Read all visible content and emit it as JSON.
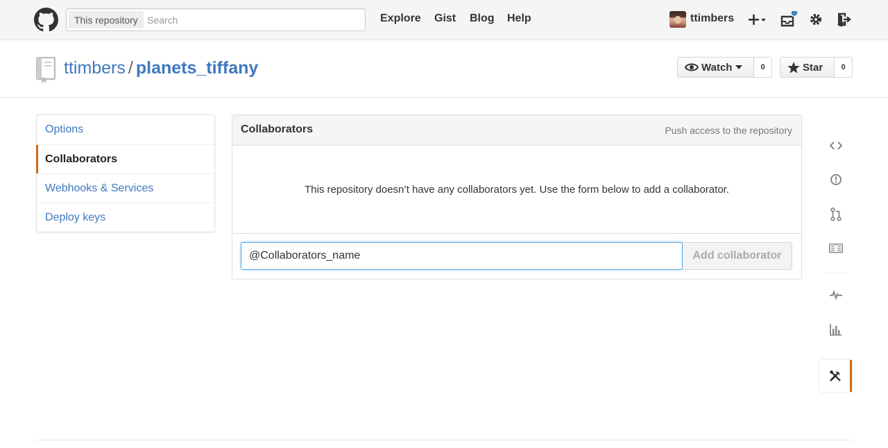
{
  "header": {
    "search_scope": "This repository",
    "search_placeholder": "Search",
    "nav": [
      "Explore",
      "Gist",
      "Blog",
      "Help"
    ],
    "username": "ttimbers"
  },
  "repo": {
    "owner": "ttimbers",
    "separator": "/",
    "name": "planets_tiffany",
    "watch_label": "Watch",
    "watch_count": "0",
    "star_label": "Star",
    "star_count": "0"
  },
  "settings_menu": {
    "items": [
      "Options",
      "Collaborators",
      "Webhooks & Services",
      "Deploy keys"
    ],
    "selected": "Collaborators"
  },
  "collaborators": {
    "title": "Collaborators",
    "meta": "Push access to the repository",
    "empty_message": "This repository doesn’t have any collaborators yet. Use the form below to add a collaborator.",
    "input_value": "@Collaborators_name",
    "add_button": "Add collaborator"
  },
  "colors": {
    "link": "#4078c0",
    "accent": "#d26911",
    "focus": "#51a7e8",
    "notification": "#4183c4"
  },
  "rail_icons": [
    "code-icon",
    "issues-icon",
    "pull-request-icon",
    "wiki-icon",
    "pulse-icon",
    "graph-icon",
    "settings-tools-icon"
  ]
}
